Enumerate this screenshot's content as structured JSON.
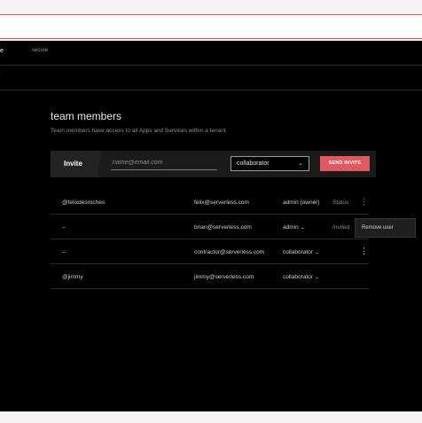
{
  "nav": {
    "active_tab": "orate",
    "tab_secure": "secure",
    "breadcrumb": "s"
  },
  "page": {
    "title": "team members",
    "subtitle": "Team members have access to all Apps and Services within a tenant."
  },
  "invite": {
    "label": "Invite",
    "email_placeholder": "name@email.com",
    "role_value": "collaborator",
    "send_label": "SEND INVITE"
  },
  "members": [
    {
      "user": "@felixdesroches",
      "email": "felix@serverless.com",
      "role": "admin (owner)",
      "status": "Status"
    },
    {
      "user": "--",
      "email": "brian@serverless.com",
      "role": "admin",
      "status": "Invited"
    },
    {
      "user": "--",
      "email": "contractor@serverless.com",
      "role": "collaborator",
      "status": ""
    },
    {
      "user": "@jimmy",
      "email": "jimmy@serverless.com",
      "role": "collaborator",
      "status": ""
    }
  ],
  "context_menu": {
    "remove_label": "Remove user"
  },
  "colors": {
    "accent": "#e2585f",
    "background": "#000000"
  },
  "icons": {
    "dropdown": "chevron-down-icon",
    "more": "more-vertical-icon"
  }
}
